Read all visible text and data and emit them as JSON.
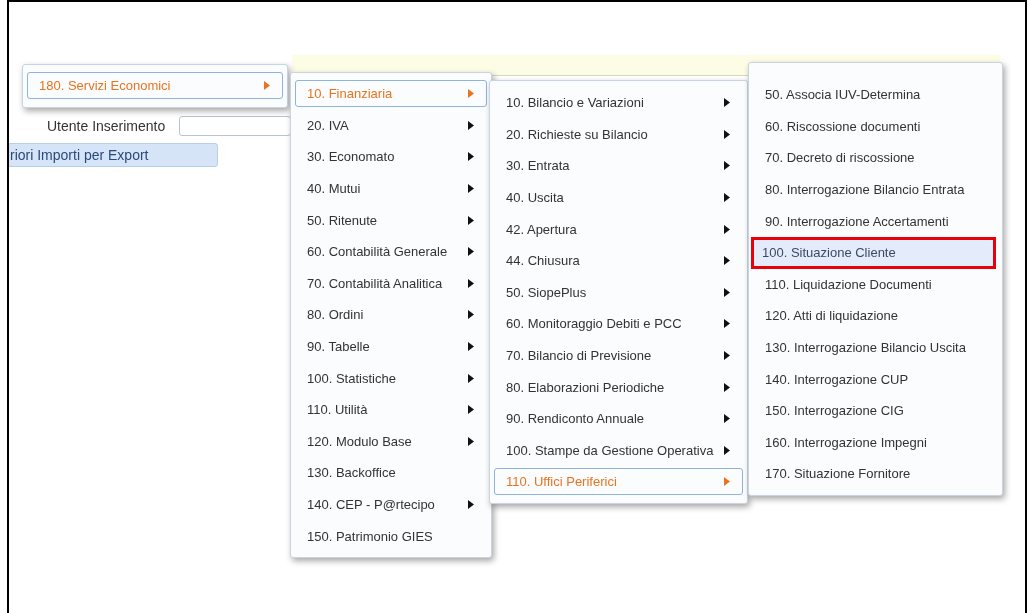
{
  "form": {
    "field_label": "Utente Inserimento",
    "export_button": "riori Importi per Export"
  },
  "menus": [
    {
      "items": [
        {
          "label": "180. Servizi Economici",
          "selected": true,
          "has_submenu": true
        }
      ]
    },
    {
      "items": [
        {
          "label": "10. Finanziaria",
          "selected": true,
          "has_submenu": true
        },
        {
          "label": "20. IVA",
          "selected": false,
          "has_submenu": true
        },
        {
          "label": "30. Economato",
          "selected": false,
          "has_submenu": true
        },
        {
          "label": "40. Mutui",
          "selected": false,
          "has_submenu": true
        },
        {
          "label": "50. Ritenute",
          "selected": false,
          "has_submenu": true
        },
        {
          "label": "60. Contabilità Generale",
          "selected": false,
          "has_submenu": true
        },
        {
          "label": "70. Contabilità Analitica",
          "selected": false,
          "has_submenu": true
        },
        {
          "label": "80. Ordini",
          "selected": false,
          "has_submenu": true
        },
        {
          "label": "90. Tabelle",
          "selected": false,
          "has_submenu": true
        },
        {
          "label": "100. Statistiche",
          "selected": false,
          "has_submenu": true
        },
        {
          "label": "110. Utilità",
          "selected": false,
          "has_submenu": true
        },
        {
          "label": "120. Modulo Base",
          "selected": false,
          "has_submenu": true
        },
        {
          "label": "130. Backoffice",
          "selected": false,
          "has_submenu": false
        },
        {
          "label": "140. CEP - P@rtecipo",
          "selected": false,
          "has_submenu": true
        },
        {
          "label": "150. Patrimonio GIES",
          "selected": false,
          "has_submenu": false
        }
      ]
    },
    {
      "items": [
        {
          "label": "10. Bilancio e Variazioni",
          "selected": false,
          "has_submenu": true
        },
        {
          "label": "20. Richieste su Bilancio",
          "selected": false,
          "has_submenu": true
        },
        {
          "label": "30. Entrata",
          "selected": false,
          "has_submenu": true
        },
        {
          "label": "40. Uscita",
          "selected": false,
          "has_submenu": true
        },
        {
          "label": "42. Apertura",
          "selected": false,
          "has_submenu": true
        },
        {
          "label": "44. Chiusura",
          "selected": false,
          "has_submenu": true
        },
        {
          "label": "50. SiopePlus",
          "selected": false,
          "has_submenu": true
        },
        {
          "label": "60. Monitoraggio Debiti e PCC",
          "selected": false,
          "has_submenu": true
        },
        {
          "label": "70. Bilancio di Previsione",
          "selected": false,
          "has_submenu": true
        },
        {
          "label": "80. Elaborazioni Periodiche",
          "selected": false,
          "has_submenu": true
        },
        {
          "label": "90. Rendiconto Annuale",
          "selected": false,
          "has_submenu": true
        },
        {
          "label": "100. Stampe da Gestione Operativa",
          "selected": false,
          "has_submenu": true
        },
        {
          "label": "110. Uffici Periferici",
          "selected": true,
          "has_submenu": true
        }
      ]
    },
    {
      "items": [
        {
          "label": "50. Associa IUV-Determina",
          "selected": false,
          "has_submenu": false,
          "hovered": false,
          "marked": false
        },
        {
          "label": "60. Riscossione documenti",
          "selected": false,
          "has_submenu": false,
          "hovered": false,
          "marked": false
        },
        {
          "label": "70. Decreto di riscossione",
          "selected": false,
          "has_submenu": false,
          "hovered": false,
          "marked": false
        },
        {
          "label": "80. Interrogazione Bilancio Entrata",
          "selected": false,
          "has_submenu": false,
          "hovered": false,
          "marked": false
        },
        {
          "label": "90. Interrogazione Accertamenti",
          "selected": false,
          "has_submenu": false,
          "hovered": false,
          "marked": false
        },
        {
          "label": "100. Situazione Cliente",
          "selected": false,
          "has_submenu": false,
          "hovered": true,
          "marked": true
        },
        {
          "label": "110. Liquidazione Documenti",
          "selected": false,
          "has_submenu": false,
          "hovered": false,
          "marked": false
        },
        {
          "label": "120. Atti di liquidazione",
          "selected": false,
          "has_submenu": false,
          "hovered": false,
          "marked": false
        },
        {
          "label": "130. Interrogazione Bilancio Uscita",
          "selected": false,
          "has_submenu": false,
          "hovered": false,
          "marked": false
        },
        {
          "label": "140. Interrogazione CUP",
          "selected": false,
          "has_submenu": false,
          "hovered": false,
          "marked": false
        },
        {
          "label": "150. Interrogazione CIG",
          "selected": false,
          "has_submenu": false,
          "hovered": false,
          "marked": false
        },
        {
          "label": "160. Interrogazione Impegni",
          "selected": false,
          "has_submenu": false,
          "hovered": false,
          "marked": false
        },
        {
          "label": "170. Situazione Fornitore",
          "selected": false,
          "has_submenu": false,
          "hovered": false,
          "marked": false
        }
      ]
    }
  ]
}
